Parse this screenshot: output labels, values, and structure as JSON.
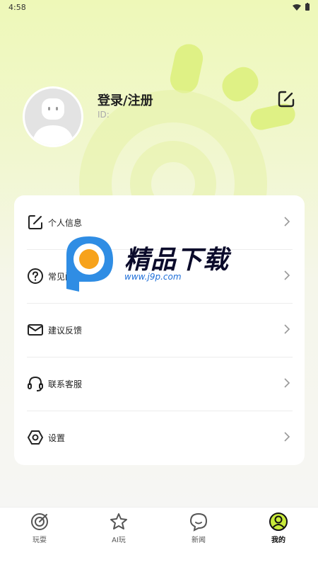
{
  "status_bar": {
    "time": "4:58"
  },
  "profile": {
    "name": "登录/注册",
    "id_label": "ID:"
  },
  "menu": [
    {
      "label": "个人信息",
      "icon": "edit-icon"
    },
    {
      "label": "常见问题",
      "icon": "question-icon"
    },
    {
      "label": "建议反馈",
      "icon": "mail-icon"
    },
    {
      "label": "联系客服",
      "icon": "headset-icon"
    },
    {
      "label": "设置",
      "icon": "settings-icon"
    }
  ],
  "watermark": {
    "title": "精品下载",
    "url": "www.j9p.com"
  },
  "bottom_nav": [
    {
      "label": "玩耍",
      "icon": "target-icon",
      "active": false
    },
    {
      "label": "AI玩",
      "icon": "star-icon",
      "active": false
    },
    {
      "label": "新闻",
      "icon": "chat-icon",
      "active": false
    },
    {
      "label": "我的",
      "icon": "user-icon",
      "active": true
    }
  ],
  "colors": {
    "accent": "#c8ea3a",
    "background_top": "#eef8b8"
  }
}
